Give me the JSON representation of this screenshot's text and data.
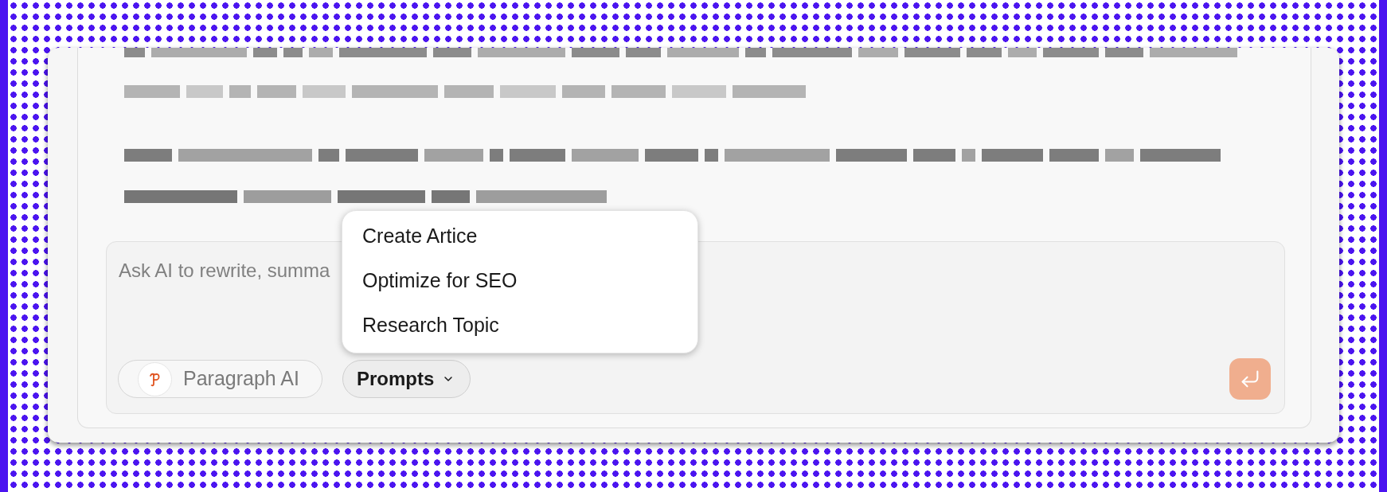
{
  "editor": {
    "composer": {
      "placeholder": "Ask AI to rewrite, summa",
      "assistant_button": {
        "label": "Paragraph AI"
      },
      "prompts_button": {
        "label": "Prompts",
        "expanded": true
      },
      "send_button": {
        "disabled": true
      }
    },
    "prompts_menu": {
      "items": [
        {
          "label": "Create Artice"
        },
        {
          "label": "Optimize for SEO"
        },
        {
          "label": "Research Topic"
        }
      ]
    }
  }
}
